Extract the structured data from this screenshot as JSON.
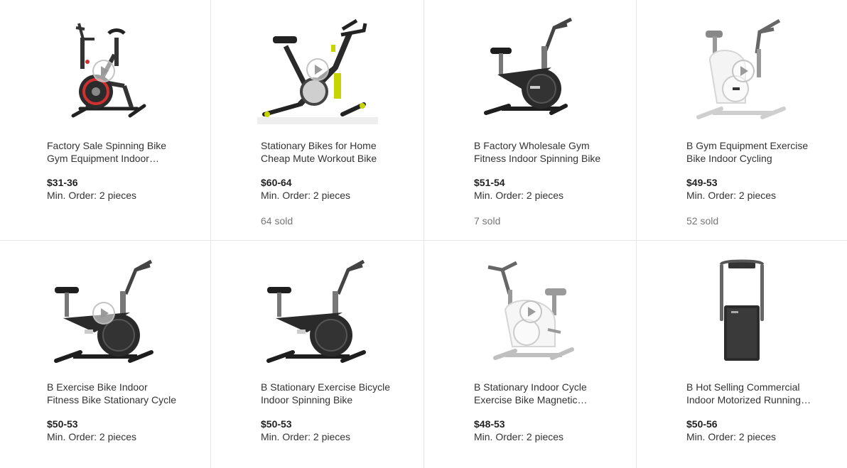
{
  "products": [
    {
      "title": "Factory Sale Spinning Bike Gym Equipment Indoor Cycling Bike",
      "price": "$31-36",
      "moq": "Min. Order: 2 pieces",
      "sold": "",
      "image_icon": "red-spin-bike",
      "has_video": true
    },
    {
      "title": "Stationary Bikes for Home Cheap Mute Workout Bike",
      "price": "$60-64",
      "moq": "Min. Order: 2 pieces",
      "sold": "64 sold",
      "image_icon": "yellow-spin-bike",
      "has_video": true
    },
    {
      "title": "B Factory Wholesale Gym Fitness Indoor Spinning Bike",
      "price": "$51-54",
      "moq": "Min. Order: 2 pieces",
      "sold": "7 sold",
      "image_icon": "black-spin-bike",
      "has_video": false
    },
    {
      "title": "B Gym Equipment Exercise Bike Indoor Cycling",
      "price": "$49-53",
      "moq": "Min. Order: 2 pieces",
      "sold": "52 sold",
      "image_icon": "white-spin-bike",
      "has_video": true
    },
    {
      "title": "B Exercise Bike Indoor Fitness Bike Stationary Cycle",
      "price": "$50-53",
      "moq": "Min. Order: 2 pieces",
      "sold": "",
      "image_icon": "black-spin-bike",
      "has_video": true
    },
    {
      "title": "B Stationary Exercise Bicycle Indoor Spinning Bike",
      "price": "$50-53",
      "moq": "Min. Order: 2 pieces",
      "sold": "",
      "image_icon": "black-spin-bike",
      "has_video": false
    },
    {
      "title": "B Stationary Indoor Cycle Exercise Bike Magnetic Resistance",
      "price": "$48-53",
      "moq": "Min. Order: 2 pieces",
      "sold": "",
      "image_icon": "white-spin-bike",
      "has_video": true
    },
    {
      "title": "B Hot Selling Commercial Indoor Motorized Running Machine",
      "price": "$50-56",
      "moq": "Min. Order: 2 pieces",
      "sold": "",
      "image_icon": "folding-treadmill",
      "has_video": false
    }
  ]
}
